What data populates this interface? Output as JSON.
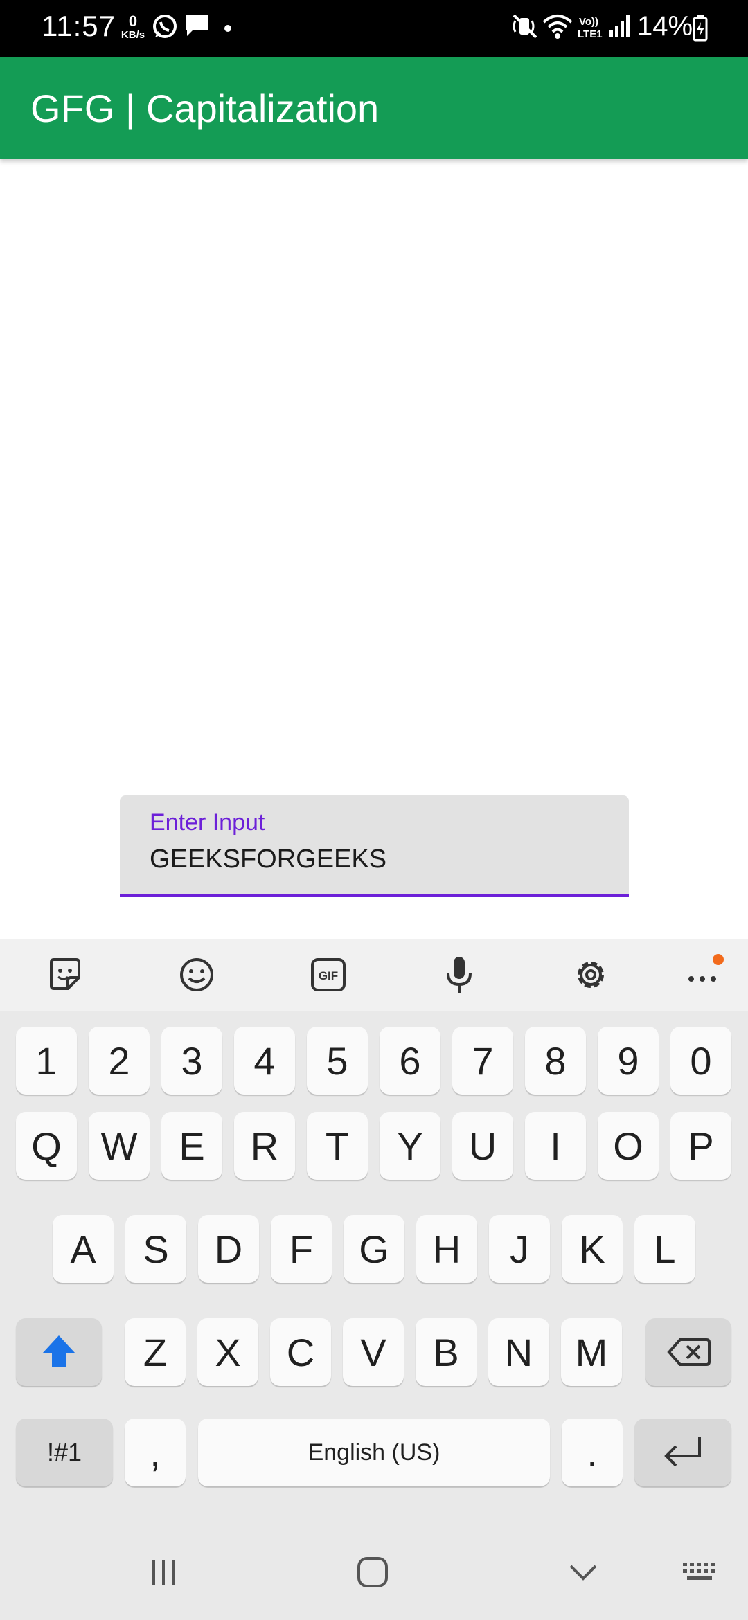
{
  "status_bar": {
    "time": "11:57",
    "net_speed_value": "0",
    "net_speed_unit": "KB/s",
    "battery": "14%",
    "icons": [
      "whatsapp-icon",
      "message-icon",
      "dot-icon",
      "mute-icon",
      "wifi-icon",
      "volte-icon",
      "signal-icon",
      "battery-charging-icon"
    ]
  },
  "app_bar": {
    "title": "GFG | Capitalization",
    "color": "#149c55"
  },
  "input": {
    "label": "Enter Input",
    "value": "GEEKSFORGEEKS",
    "accent": "#6c20d8"
  },
  "keyboard": {
    "toolbar": [
      "sticker-icon",
      "emoji-icon",
      "gif-icon",
      "mic-icon",
      "settings-icon",
      "more-icon"
    ],
    "number_row": [
      "1",
      "2",
      "3",
      "4",
      "5",
      "6",
      "7",
      "8",
      "9",
      "0"
    ],
    "row1": [
      "Q",
      "W",
      "E",
      "R",
      "T",
      "Y",
      "U",
      "I",
      "O",
      "P"
    ],
    "row2": [
      "A",
      "S",
      "D",
      "F",
      "G",
      "H",
      "J",
      "K",
      "L"
    ],
    "row3": [
      "Z",
      "X",
      "C",
      "V",
      "B",
      "N",
      "M"
    ],
    "symbols_key": "!#1",
    "comma_key": ",",
    "space_label": "English (US)",
    "period_key": ".",
    "shift_color": "#1a73e8"
  },
  "nav_bar": [
    "recents-icon",
    "home-icon",
    "back-icon",
    "keyboard-switch-icon"
  ]
}
